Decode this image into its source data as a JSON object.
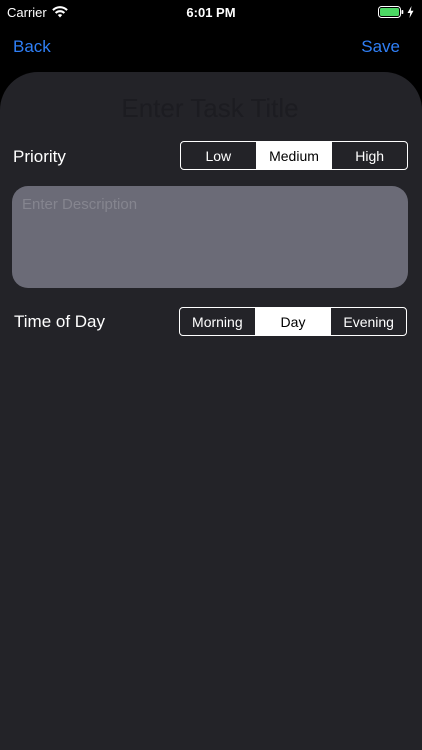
{
  "status_bar": {
    "carrier": "Carrier",
    "time": "6:01 PM"
  },
  "nav": {
    "back_label": "Back",
    "save_label": "Save",
    "accent_color": "#2f7ff6"
  },
  "form": {
    "title_placeholder": "Enter Task Title",
    "priority": {
      "label": "Priority",
      "options": [
        "Low",
        "Medium",
        "High"
      ],
      "selected": "Medium"
    },
    "description_placeholder": "Enter Description",
    "time_of_day": {
      "label": "Time of Day",
      "options": [
        "Morning",
        "Day",
        "Evening"
      ],
      "selected": "Day"
    }
  }
}
